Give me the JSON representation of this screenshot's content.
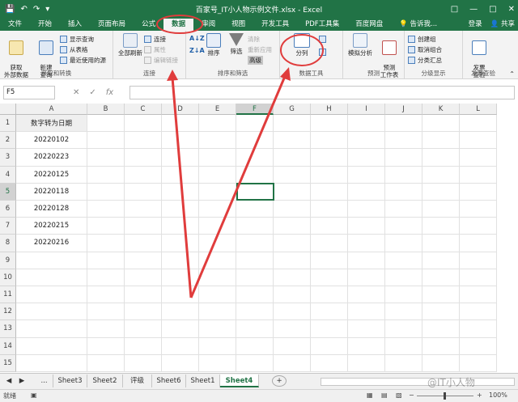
{
  "title": "百家号_IT小人物示例文件.xlsx - Excel",
  "menu": {
    "tabs": [
      "文件",
      "开始",
      "插入",
      "页面布局",
      "公式",
      "数据",
      "审阅",
      "视图",
      "开发工具",
      "PDF工具集",
      "百度网盘"
    ],
    "tell_me": "告诉我...",
    "login": "登录",
    "share": "共享"
  },
  "ribbon": {
    "get_external": "获取\n外部数据",
    "new_query": "新建\n查询",
    "show_query": "显示查询",
    "from_table": "从表格",
    "recent_source": "最近使用的源",
    "group_get": "获取和转换",
    "refresh_all": "全部刷新",
    "connections": "连接",
    "properties": "属性",
    "edit_links": "编辑链接",
    "group_connections": "连接",
    "sort": "排序",
    "filter": "筛选",
    "clear": "清除",
    "reapply": "重新应用",
    "advanced": "高级",
    "group_sort": "排序和筛选",
    "text_to_columns": "分列",
    "group_datatools": "数据工具",
    "whatif": "模拟分析",
    "forecast_sheet": "预测\n工作表",
    "group_forecast": "预测",
    "group_create": "创建组",
    "ungroup": "取消组合",
    "subtotal": "分类汇总",
    "group_outline": "分级显示",
    "invoice_check": "发票\n查验",
    "group_invoice": "发票查验"
  },
  "namebox": "F5",
  "columns": [
    "A",
    "B",
    "C",
    "D",
    "E",
    "F",
    "G",
    "H",
    "I",
    "J",
    "K",
    "L"
  ],
  "rows": [
    "1",
    "2",
    "3",
    "4",
    "5",
    "6",
    "7",
    "8",
    "9",
    "10",
    "11",
    "12",
    "13",
    "14",
    "15"
  ],
  "cells": {
    "header": "数字转为日期",
    "values": [
      "20220102",
      "20220223",
      "20220125",
      "20220118",
      "20220128",
      "20220215",
      "20220216"
    ]
  },
  "sheets": [
    "...",
    "Sheet3",
    "Sheet2",
    "评级",
    "Sheet6",
    "Sheet1",
    "Sheet4"
  ],
  "active_sheet": "Sheet4",
  "status": {
    "ready": "就绪",
    "zoom": "100%"
  },
  "watermark": "@IT小人物",
  "accent": "#217346",
  "annotation_color": "#e03c3c"
}
